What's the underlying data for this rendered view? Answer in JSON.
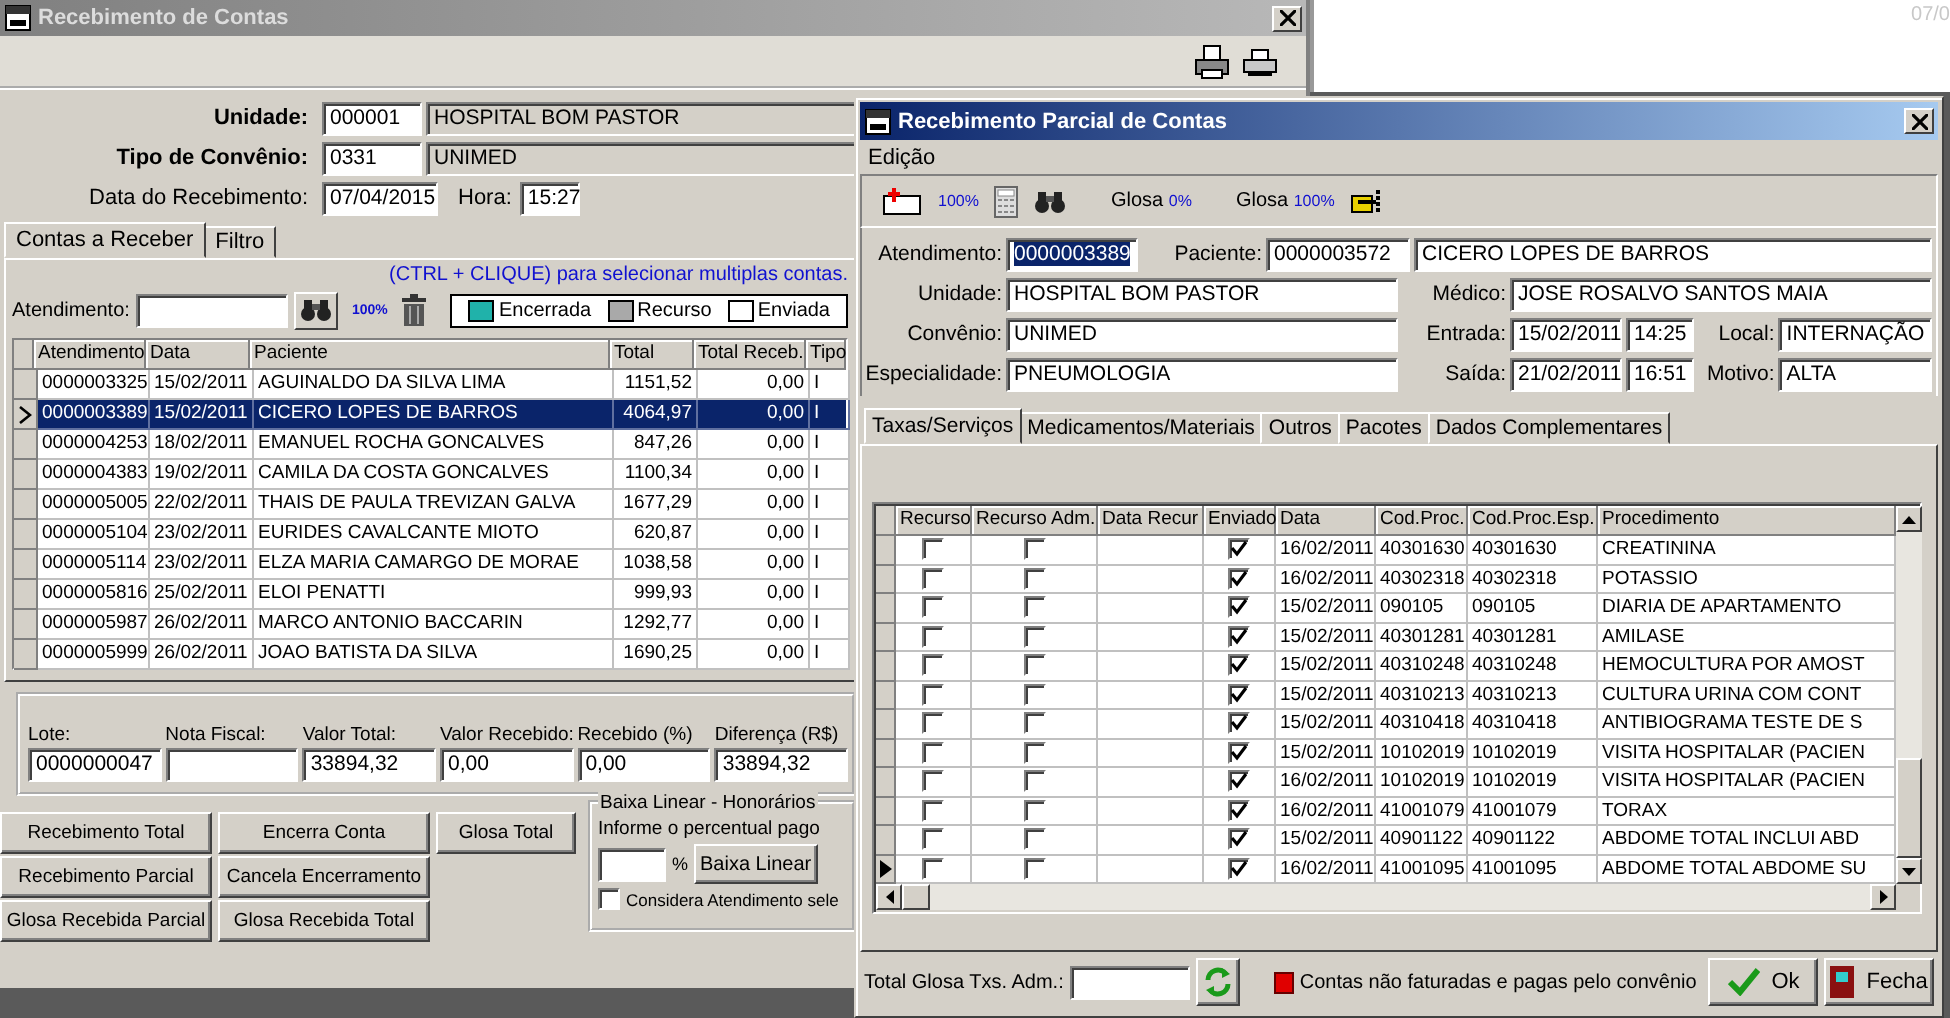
{
  "background_window": {
    "text": "07/0"
  },
  "main_window": {
    "title": "Recebimento de Contas",
    "unidade": {
      "label": "Unidade:",
      "code": "000001",
      "name": "HOSPITAL BOM PASTOR"
    },
    "tipo_convenio": {
      "label": "Tipo de Convênio:",
      "code": "0331",
      "name": "UNIMED"
    },
    "data_recebimento": {
      "label": "Data do Recebimento:",
      "value": "07/04/2015"
    },
    "hora": {
      "label": "Hora:",
      "value": "15:27"
    },
    "tabs": [
      {
        "label": "Contas a Receber",
        "selected": true
      },
      {
        "label": "Filtro",
        "selected": false
      }
    ],
    "hint": "(CTRL + CLIQUE) para selecionar multiplas contas.",
    "atendimento_label": "Atendimento:",
    "percent_label": "100%",
    "legend": [
      {
        "label": "Encerrada",
        "color": "#20b2aa"
      },
      {
        "label": "Recurso",
        "color": "#a9a9a9"
      },
      {
        "label": "Enviada",
        "color": "#ffffff"
      }
    ],
    "table": {
      "columns": [
        "Atendimento",
        "Data",
        "Paciente",
        "Total",
        "Total Receb.",
        "Tipo"
      ],
      "rows": [
        {
          "cells": [
            "0000003325",
            "15/02/2011",
            "AGUINALDO DA SILVA LIMA",
            "1151,52",
            "0,00",
            "I"
          ],
          "selected": false
        },
        {
          "cells": [
            "0000003389",
            "15/02/2011",
            "CICERO LOPES DE BARROS",
            "4064,97",
            "0,00",
            "I"
          ],
          "selected": true
        },
        {
          "cells": [
            "0000004253",
            "18/02/2011",
            "EMANUEL ROCHA GONCALVES",
            "847,26",
            "0,00",
            "I"
          ],
          "selected": false
        },
        {
          "cells": [
            "0000004383",
            "19/02/2011",
            "CAMILA DA COSTA GONCALVES",
            "1100,34",
            "0,00",
            "I"
          ],
          "selected": false
        },
        {
          "cells": [
            "0000005005",
            "22/02/2011",
            "THAIS DE PAULA TREVIZAN GALVA",
            "1677,29",
            "0,00",
            "I"
          ],
          "selected": false
        },
        {
          "cells": [
            "0000005104",
            "23/02/2011",
            "EURIDES CAVALCANTE MIOTO",
            "620,87",
            "0,00",
            "I"
          ],
          "selected": false
        },
        {
          "cells": [
            "0000005114",
            "23/02/2011",
            "ELZA MARIA CAMARGO DE MORAE",
            "1038,58",
            "0,00",
            "I"
          ],
          "selected": false
        },
        {
          "cells": [
            "0000005816",
            "25/02/2011",
            "ELOI PENATTI",
            "999,93",
            "0,00",
            "I"
          ],
          "selected": false
        },
        {
          "cells": [
            "0000005987",
            "26/02/2011",
            "MARCO ANTONIO BACCARIN",
            "1292,77",
            "0,00",
            "I"
          ],
          "selected": false
        },
        {
          "cells": [
            "0000005999",
            "26/02/2011",
            "JOAO BATISTA DA SILVA",
            "1690,25",
            "0,00",
            "I"
          ],
          "selected": false
        }
      ]
    },
    "totals": [
      {
        "label": "Lote:",
        "value": "0000000047"
      },
      {
        "label": "Nota Fiscal:"
      },
      {
        "label": "Valor Total:",
        "value": "33894,32"
      },
      {
        "label": "Valor Recebido:",
        "value": "0,00"
      },
      {
        "label": "Recebido (%)",
        "value": "0,00"
      },
      {
        "label": "Diferença (R$)",
        "value": "33894,32"
      }
    ],
    "buttons": [
      [
        "Recebimento Total",
        "Recebimento Parcial",
        "Glosa Recebida Parcial"
      ],
      [
        "Encerra Conta",
        "Cancela Encerramento",
        "Glosa Recebida Total"
      ],
      [
        "Glosa Total"
      ]
    ],
    "baixa_linear": {
      "title": "Baixa Linear - Honorários",
      "prompt": "Informe o percentual pago",
      "percent_sign": "%",
      "button": "Baixa Linear",
      "checkbox": {
        "label": "Considera Atendimento sele",
        "checked": false
      }
    }
  },
  "dialog": {
    "title": "Recebimento Parcial de Contas",
    "menu": [
      "Edição"
    ],
    "toolbar": {
      "percent": "100%",
      "glosa": [
        {
          "label": "Glosa",
          "value": "0%"
        },
        {
          "label": "Glosa",
          "value": "100%"
        }
      ]
    },
    "fields": {
      "atendimento": {
        "label": "Atendimento:",
        "value": "0000003389"
      },
      "paciente": {
        "label": "Paciente:",
        "code": "0000003572",
        "name": "CICERO LOPES DE BARROS"
      },
      "unidade": {
        "label": "Unidade:",
        "value": "HOSPITAL BOM PASTOR"
      },
      "medico": {
        "label": "Médico:",
        "value": "JOSE ROSALVO SANTOS MAIA"
      },
      "convenio": {
        "label": "Convênio:",
        "value": "UNIMED"
      },
      "entrada": {
        "label": "Entrada:",
        "date": "15/02/2011",
        "time": "14:25"
      },
      "local": {
        "label": "Local:",
        "value": "INTERNAÇÃO"
      },
      "especialidade": {
        "label": "Especialidade:",
        "value": "PNEUMOLOGIA"
      },
      "saida": {
        "label": "Saída:",
        "date": "21/02/2011",
        "time": "16:51"
      },
      "motivo": {
        "label": "Motivo:",
        "value": "ALTA"
      }
    },
    "tabs": [
      {
        "label": "Taxas/Serviços",
        "selected": true
      },
      {
        "label": "Medicamentos/Materiais",
        "selected": false
      },
      {
        "label": "Outros",
        "selected": false
      },
      {
        "label": "Pacotes",
        "selected": false
      },
      {
        "label": "Dados Complementares",
        "selected": false
      }
    ],
    "grid": {
      "columns": [
        "Recurso",
        "Recurso Adm.",
        "Data Recur",
        "Enviado",
        "Data",
        "Cod.Proc.",
        "Cod.Proc.Esp.",
        "Procedimento"
      ],
      "rows": [
        {
          "recurso": false,
          "recurso_adm": false,
          "enviado": true,
          "data": "16/02/2011",
          "cod_proc": "40301630",
          "cod_proc_esp": "40301630",
          "procedimento": "CREATININA",
          "current": false
        },
        {
          "recurso": false,
          "recurso_adm": false,
          "enviado": true,
          "data": "16/02/2011",
          "cod_proc": "40302318",
          "cod_proc_esp": "40302318",
          "procedimento": "POTASSIO",
          "current": false
        },
        {
          "recurso": false,
          "recurso_adm": false,
          "enviado": true,
          "data": "15/02/2011",
          "cod_proc": "090105",
          "cod_proc_esp": "090105",
          "procedimento": "DIARIA DE APARTAMENTO",
          "current": false
        },
        {
          "recurso": false,
          "recurso_adm": false,
          "enviado": true,
          "data": "15/02/2011",
          "cod_proc": "40301281",
          "cod_proc_esp": "40301281",
          "procedimento": "AMILASE",
          "current": false
        },
        {
          "recurso": false,
          "recurso_adm": false,
          "enviado": true,
          "data": "15/02/2011",
          "cod_proc": "40310248",
          "cod_proc_esp": "40310248",
          "procedimento": "HEMOCULTURA POR AMOST",
          "current": false
        },
        {
          "recurso": false,
          "recurso_adm": false,
          "enviado": true,
          "data": "15/02/2011",
          "cod_proc": "40310213",
          "cod_proc_esp": "40310213",
          "procedimento": "CULTURA URINA COM CONT",
          "current": false
        },
        {
          "recurso": false,
          "recurso_adm": false,
          "enviado": true,
          "data": "15/02/2011",
          "cod_proc": "40310418",
          "cod_proc_esp": "40310418",
          "procedimento": "ANTIBIOGRAMA TESTE DE S",
          "current": false
        },
        {
          "recurso": false,
          "recurso_adm": false,
          "enviado": true,
          "data": "15/02/2011",
          "cod_proc": "10102019",
          "cod_proc_esp": "10102019",
          "procedimento": "VISITA HOSPITALAR (PACIEN",
          "current": false
        },
        {
          "recurso": false,
          "recurso_adm": false,
          "enviado": true,
          "data": "16/02/2011",
          "cod_proc": "10102019",
          "cod_proc_esp": "10102019",
          "procedimento": "VISITA HOSPITALAR (PACIEN",
          "current": false
        },
        {
          "recurso": false,
          "recurso_adm": false,
          "enviado": true,
          "data": "16/02/2011",
          "cod_proc": "41001079",
          "cod_proc_esp": "41001079",
          "procedimento": "TORAX",
          "current": false
        },
        {
          "recurso": false,
          "recurso_adm": false,
          "enviado": true,
          "data": "15/02/2011",
          "cod_proc": "40901122",
          "cod_proc_esp": "40901122",
          "procedimento": "ABDOME TOTAL INCLUI ABD",
          "current": false
        },
        {
          "recurso": false,
          "recurso_adm": false,
          "enviado": true,
          "data": "16/02/2011",
          "cod_proc": "41001095",
          "cod_proc_esp": "41001095",
          "procedimento": "ABDOME TOTAL ABDOME SU",
          "current": true
        }
      ]
    },
    "total_glosa_label": "Total Glosa Txs. Adm.:",
    "legend": {
      "label": "Contas não faturadas e pagas pelo convênio",
      "color": "#e00000"
    },
    "buttons": [
      "Ok",
      "Fecha"
    ]
  }
}
